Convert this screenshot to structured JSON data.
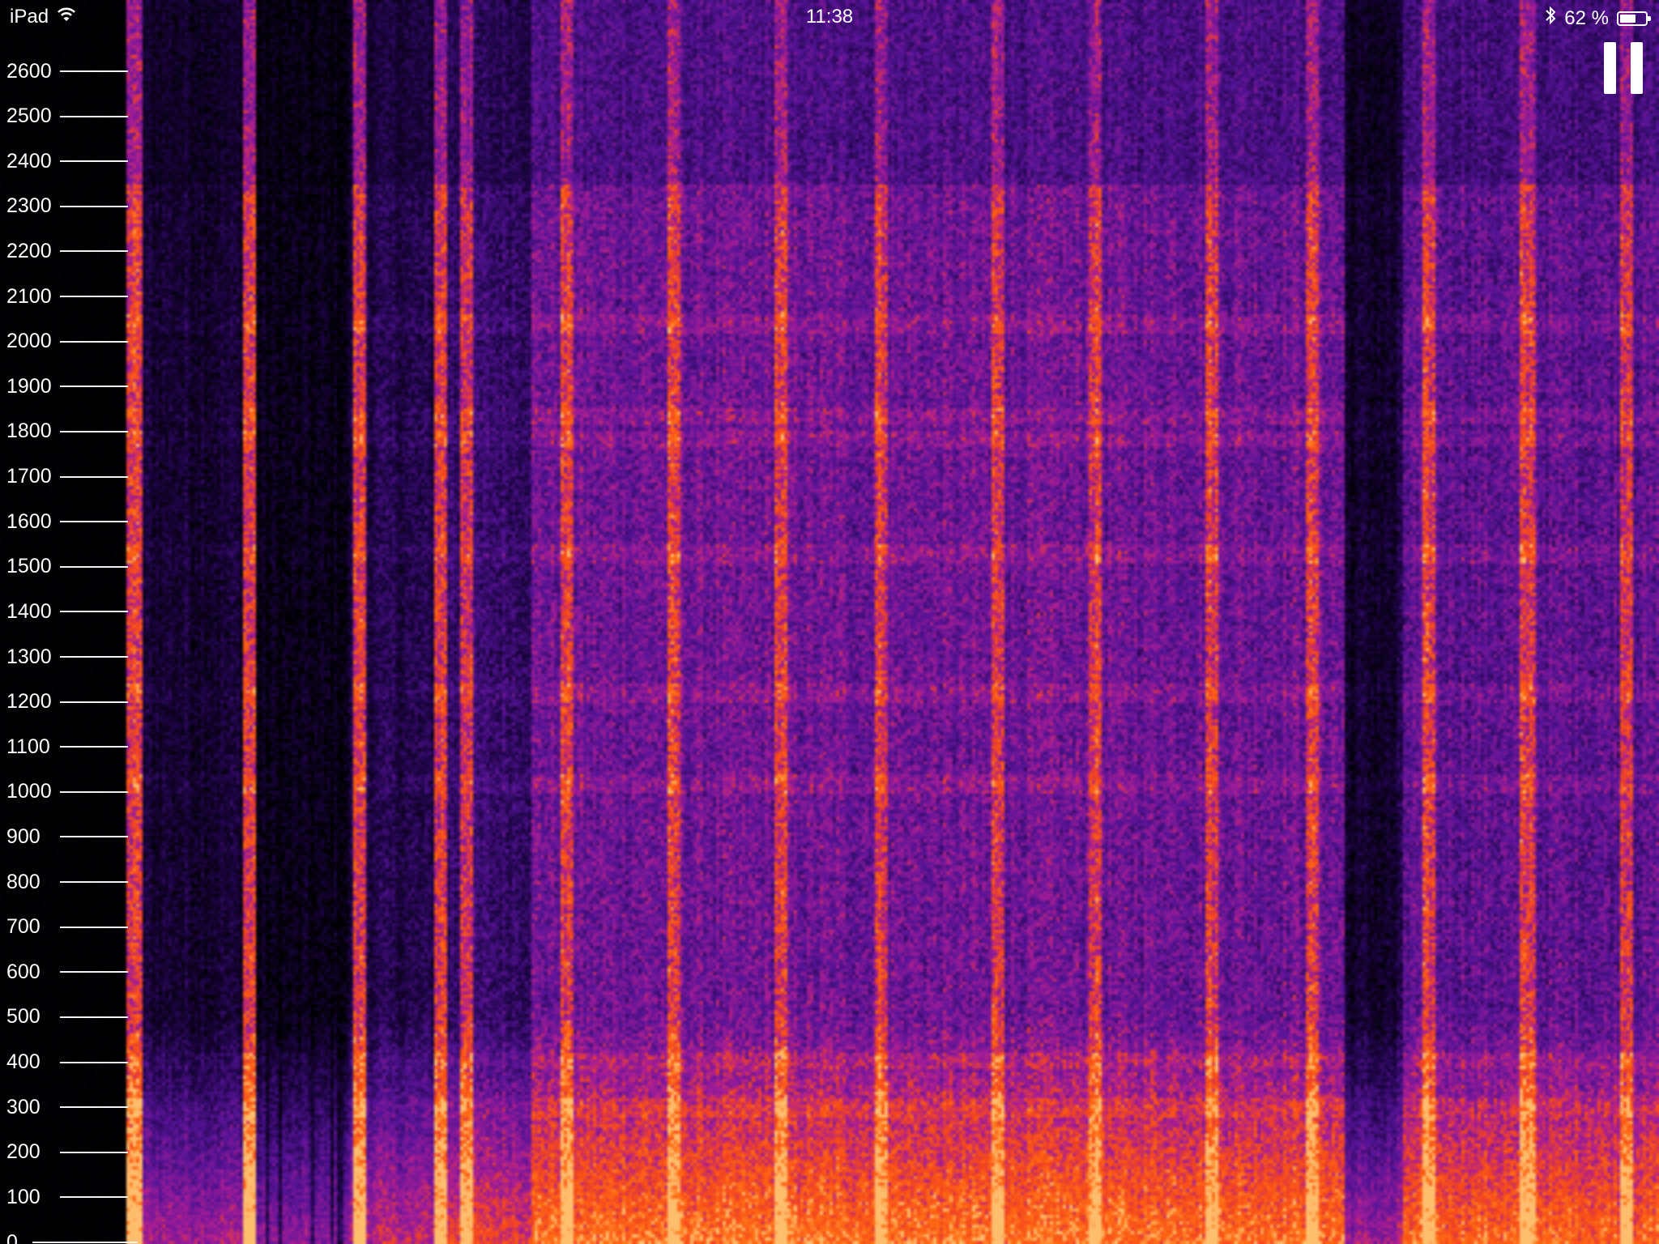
{
  "status_bar": {
    "device": "iPad",
    "time": "11:38",
    "battery_percent_text": "62 %",
    "battery_level": 0.62,
    "wifi_icon": "wifi-icon",
    "bluetooth_icon": "bluetooth-icon"
  },
  "frequency_axis": {
    "ticks": [
      "2600",
      "2500",
      "2400",
      "2300",
      "2200",
      "2100",
      "2000",
      "1900",
      "1800",
      "1700",
      "1600",
      "1500",
      "1400",
      "1300",
      "1200",
      "1100",
      "1000",
      "900",
      "800",
      "700",
      "600",
      "500",
      "400",
      "300",
      "200",
      "100",
      "0"
    ],
    "max_hz": 2700
  },
  "controls": {
    "pause_icon": "pause-icon"
  },
  "colors": {
    "background": "#000000",
    "low_intensity": "#2a0a5e",
    "mid_intensity": "#7a1fa8",
    "high_intensity": "#ff5a10",
    "peak_intensity": "#ffb060"
  }
}
